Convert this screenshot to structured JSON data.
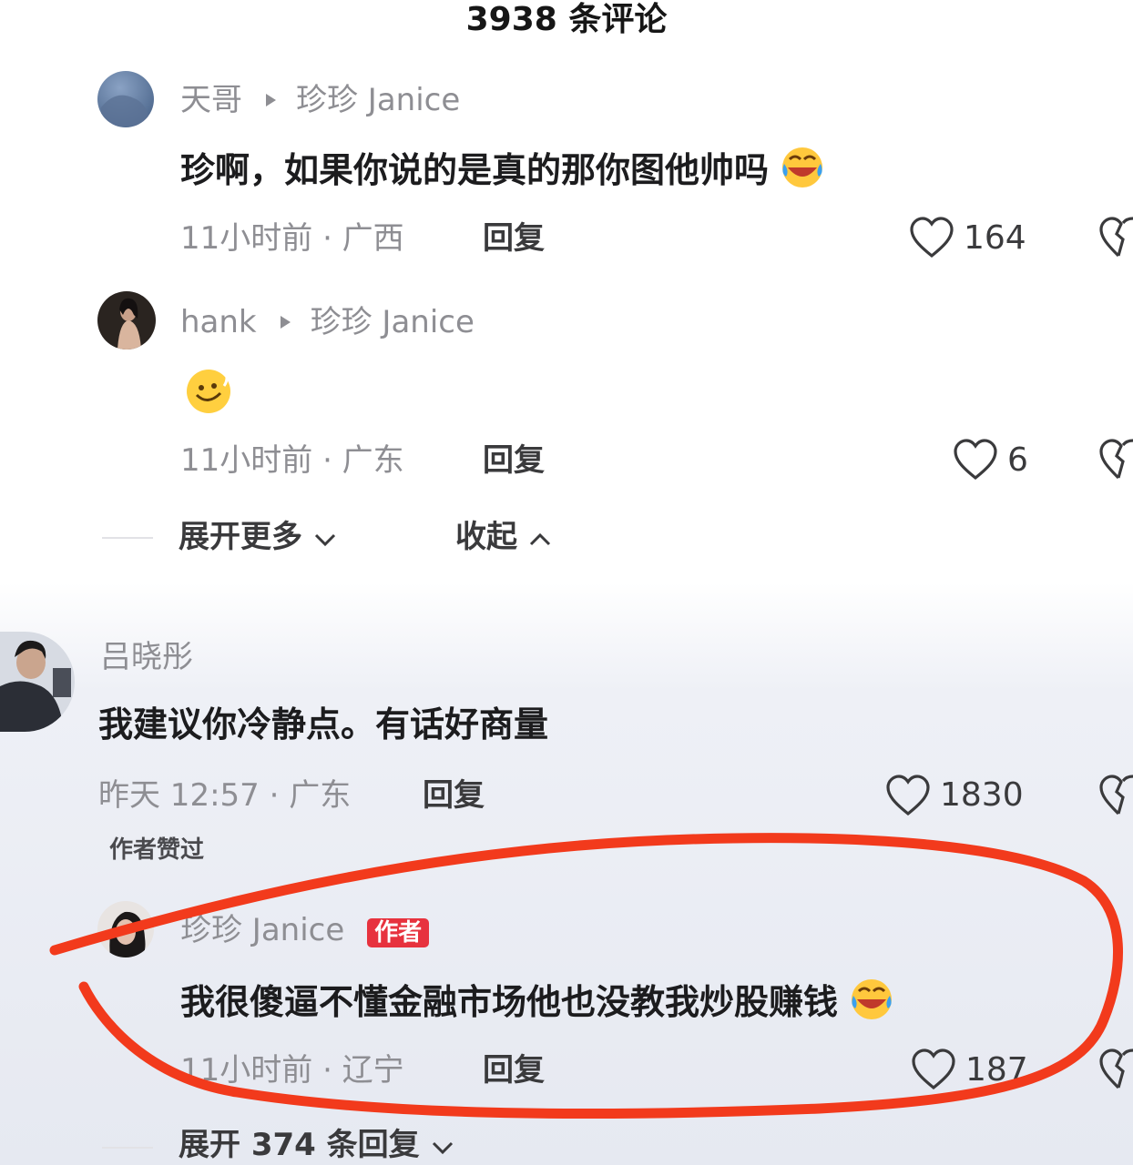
{
  "header": {
    "title": "3938 条评论"
  },
  "comments": [
    {
      "user": "天哥",
      "reply_to": "珍珍 Janice",
      "text": "珍啊，如果你说的是真的那你图他帅吗",
      "emoji": "laughing-crying-emoji",
      "meta": "11小时前 · 广西",
      "reply_label": "回复",
      "likes": "164"
    },
    {
      "user": "hank",
      "reply_to": "珍珍 Janice",
      "emoji": "smile-emoji",
      "meta": "11小时前 · 广东",
      "reply_label": "回复",
      "likes": "6"
    },
    {
      "user": "吕晓彤",
      "text": "我建议你冷静点。有话好商量",
      "meta": "昨天 12:57 · 广东",
      "reply_label": "回复",
      "likes": "1830",
      "author_liked": "作者赞过"
    },
    {
      "user": "珍珍 Janice",
      "badge": "作者",
      "text": "我很傻逼不懂金融市场他也没教我炒股赚钱",
      "emoji": "laughing-crying-emoji",
      "meta": "11小时前 · 辽宁",
      "reply_label": "回复",
      "likes": "187"
    }
  ],
  "thread_controls": {
    "expand_more": "展开更多",
    "collapse": "收起"
  },
  "expand_replies": "展开 374 条回复",
  "colors": {
    "highlight_circle": "#f23a1c",
    "author_badge": "#e7323e"
  }
}
